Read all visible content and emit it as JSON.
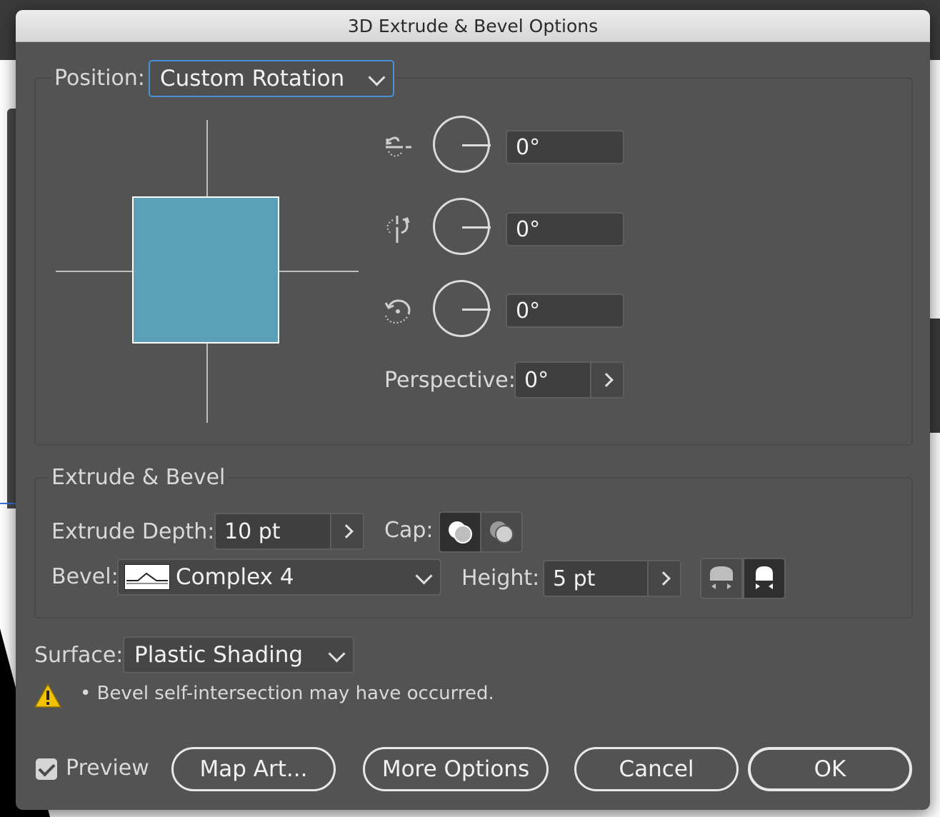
{
  "dialog": {
    "title": "3D Extrude & Bevel Options"
  },
  "position": {
    "label": "Position:",
    "selected": "Custom Rotation",
    "x_axis": {
      "icon": "rotate-x-axis-icon",
      "value": "0°"
    },
    "y_axis": {
      "icon": "rotate-y-axis-icon",
      "value": "0°"
    },
    "z_axis": {
      "icon": "rotate-z-axis-icon",
      "value": "0°"
    },
    "perspective": {
      "label": "Perspective:",
      "value": "0°"
    },
    "preview_color": "#5ca0b8"
  },
  "extrude": {
    "section_label": "Extrude & Bevel",
    "depth_label": "Extrude Depth:",
    "depth_value": "10 pt",
    "cap_label": "Cap:",
    "bevel_label": "Bevel:",
    "bevel_value": "Complex 4",
    "height_label": "Height:",
    "height_value": "5 pt"
  },
  "surface": {
    "label": "Surface:",
    "value": "Plastic Shading"
  },
  "warning": {
    "text": "• Bevel self-intersection may have occurred."
  },
  "footer": {
    "preview_label": "Preview",
    "map_art": "Map Art...",
    "more_options": "More Options",
    "cancel": "Cancel",
    "ok": "OK"
  }
}
